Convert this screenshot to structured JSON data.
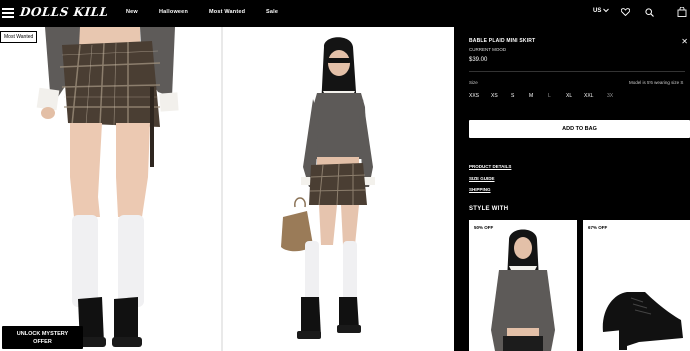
{
  "header": {
    "logo": "DOLLS KILL",
    "nav": [
      "New",
      "Halloween",
      "Most Wanted",
      "Sale"
    ],
    "region": "US"
  },
  "gallery": {
    "badge": "Most Wanted",
    "unlock_line1": "UNLOCK MYSTERY",
    "unlock_line2": "OFFER"
  },
  "product": {
    "title": "BABLE PLAID MINI SKIRT",
    "mood": "CURRENT MOOD",
    "price": "$39.00",
    "size_label": "Size",
    "model_note": "Model is 5'6 wearing size S",
    "sizes": [
      {
        "label": "XXS",
        "available": true
      },
      {
        "label": "XS",
        "available": true
      },
      {
        "label": "S",
        "available": true
      },
      {
        "label": "M",
        "available": true
      },
      {
        "label": "L",
        "available": false
      },
      {
        "label": "XL",
        "available": true
      },
      {
        "label": "XXL",
        "available": true
      },
      {
        "label": "3X",
        "available": false
      }
    ],
    "add_to_bag": "ADD TO BAG",
    "links": [
      "PRODUCT DETAILS",
      "SIZE GUIDE",
      "SHIPPING"
    ],
    "style_with": "STYLE WITH",
    "recommendations": [
      {
        "discount": "50% OFF"
      },
      {
        "discount": "67% OFF"
      }
    ]
  },
  "colors": {
    "header_bg": "#000000",
    "panel_bg": "#000000",
    "skirt_plaid": "#4a3e33",
    "top": "#5d5a58"
  }
}
